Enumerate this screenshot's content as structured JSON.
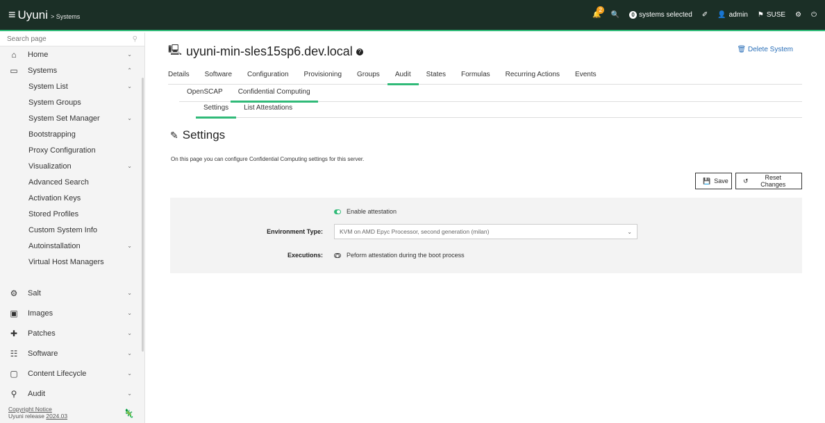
{
  "header": {
    "app_name": "Uyuni",
    "breadcrumb": "> Systems",
    "notification_count": "2",
    "systems_selected_count": "0",
    "systems_selected_label": "systems selected",
    "user": "admin",
    "org": "SUSE"
  },
  "sidebar": {
    "search_placeholder": "Search page",
    "items": [
      {
        "label": "Home",
        "icon": "home-icon"
      },
      {
        "label": "Systems",
        "icon": "monitor-icon"
      },
      {
        "label": "System List"
      },
      {
        "label": "System Groups"
      },
      {
        "label": "System Set Manager"
      },
      {
        "label": "Bootstrapping"
      },
      {
        "label": "Proxy Configuration"
      },
      {
        "label": "Visualization"
      },
      {
        "label": "Advanced Search"
      },
      {
        "label": "Activation Keys"
      },
      {
        "label": "Stored Profiles"
      },
      {
        "label": "Custom System Info"
      },
      {
        "label": "Autoinstallation"
      },
      {
        "label": "Virtual Host Managers"
      },
      {
        "label": "Salt",
        "icon": "salt-icon"
      },
      {
        "label": "Images",
        "icon": "images-icon"
      },
      {
        "label": "Patches",
        "icon": "patches-icon"
      },
      {
        "label": "Software",
        "icon": "software-icon"
      },
      {
        "label": "Content Lifecycle",
        "icon": "lifecycle-icon"
      },
      {
        "label": "Audit",
        "icon": "audit-icon"
      }
    ],
    "footer": {
      "copyright": "Copyright Notice",
      "release_prefix": "Uyuni release",
      "release": "2024.03"
    }
  },
  "page": {
    "system_name": "uyuni-min-sles15sp6.dev.local",
    "delete_label": "Delete System",
    "tabs": [
      "Details",
      "Software",
      "Configuration",
      "Provisioning",
      "Groups",
      "Audit",
      "States",
      "Formulas",
      "Recurring Actions",
      "Events"
    ],
    "subtabs": [
      "OpenSCAP",
      "Confidential Computing"
    ],
    "subsubtabs": [
      "Settings",
      "List Attestations"
    ],
    "section_title": "Settings",
    "description": "On this page you can configure Confidential Computing settings for this server.",
    "save_label": "Save",
    "reset_label": "Reset Changes"
  },
  "form": {
    "enable_label": "Enable attestation",
    "env_label": "Environment Type:",
    "env_value": "KVM on AMD Epyc Processor, second generation (milan)",
    "exec_label": "Executions:",
    "exec_value": "Peform attestation during the boot process"
  },
  "colors": {
    "header_bg": "#1b2f26",
    "accent": "#30ba78",
    "link": "#2a6fb8"
  }
}
